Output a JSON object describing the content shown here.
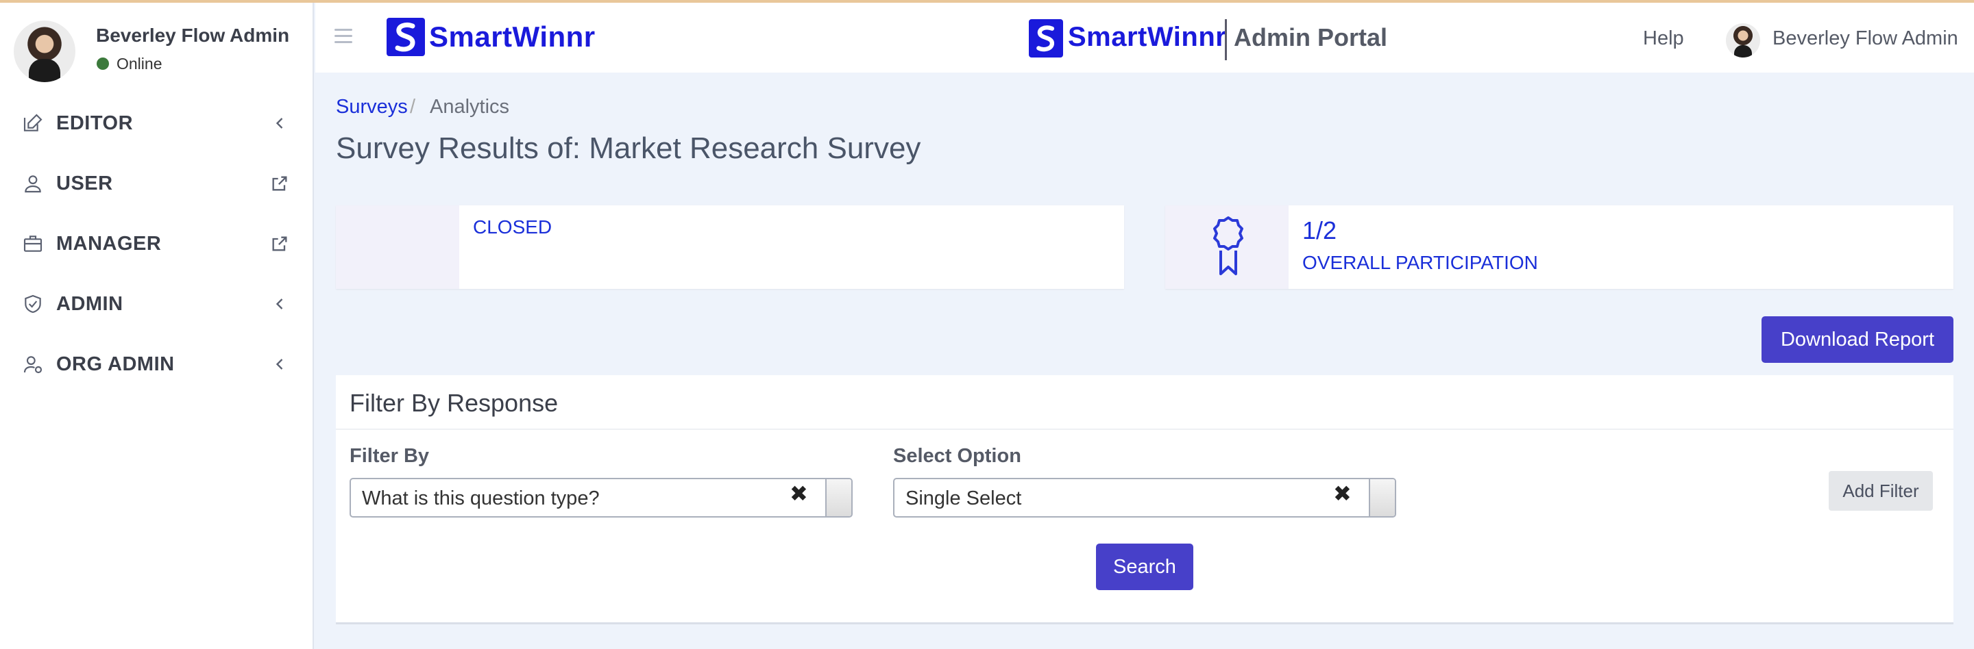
{
  "sidebar": {
    "user": {
      "name": "Beverley Flow Admin",
      "status": "Online"
    },
    "items": [
      {
        "label": "EDITOR",
        "icon": "edit-icon",
        "indicator": "chevron-left-icon"
      },
      {
        "label": "USER",
        "icon": "user-icon",
        "indicator": "external-link-icon"
      },
      {
        "label": "MANAGER",
        "icon": "briefcase-icon",
        "indicator": "external-link-icon"
      },
      {
        "label": "ADMIN",
        "icon": "shield-check-icon",
        "indicator": "chevron-left-icon"
      },
      {
        "label": "ORG ADMIN",
        "icon": "user-settings-icon",
        "indicator": "chevron-left-icon"
      }
    ]
  },
  "header": {
    "brand": "SmartWinnr",
    "portal": "Admin Portal",
    "help": "Help",
    "user_name": "Beverley Flow Admin"
  },
  "breadcrumb": {
    "surveys": "Surveys",
    "separator": "/",
    "current": "Analytics"
  },
  "page": {
    "title": "Survey Results of: Market Research Survey"
  },
  "status_box": {
    "status": "CLOSED"
  },
  "participation_box": {
    "count": "1/2",
    "label": "OVERALL PARTICIPATION",
    "icon": "award-ribbon-icon"
  },
  "download_button": "Download Report",
  "filter": {
    "title": "Filter By Response",
    "filter_by_label": "Filter By",
    "filter_by_value": "What is this question type?",
    "select_option_label": "Select Option",
    "select_option_value": "Single Select",
    "clear_symbol": "✖",
    "add_filter": "Add Filter",
    "search": "Search"
  },
  "colors": {
    "brand": "#1a1adb",
    "primary_button": "#4740c9",
    "link": "#1a2fd9",
    "online": "#3c7a3c",
    "background": "#eef3fb"
  }
}
